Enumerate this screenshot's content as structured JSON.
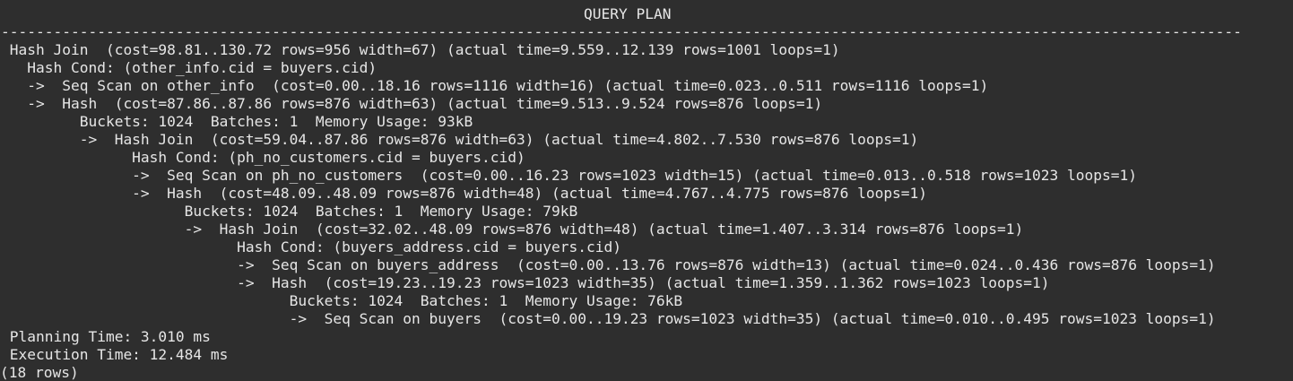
{
  "terminal": {
    "header": "QUERY PLAN",
    "separator": "----------------------------------------------------------------------------------------------------------------------------------------------",
    "plan_lines": [
      " Hash Join  (cost=98.81..130.72 rows=956 width=67) (actual time=9.559..12.139 rows=1001 loops=1)",
      "   Hash Cond: (other_info.cid = buyers.cid)",
      "   ->  Seq Scan on other_info  (cost=0.00..18.16 rows=1116 width=16) (actual time=0.023..0.511 rows=1116 loops=1)",
      "   ->  Hash  (cost=87.86..87.86 rows=876 width=63) (actual time=9.513..9.524 rows=876 loops=1)",
      "         Buckets: 1024  Batches: 1  Memory Usage: 93kB",
      "         ->  Hash Join  (cost=59.04..87.86 rows=876 width=63) (actual time=4.802..7.530 rows=876 loops=1)",
      "               Hash Cond: (ph_no_customers.cid = buyers.cid)",
      "               ->  Seq Scan on ph_no_customers  (cost=0.00..16.23 rows=1023 width=15) (actual time=0.013..0.518 rows=1023 loops=1)",
      "               ->  Hash  (cost=48.09..48.09 rows=876 width=48) (actual time=4.767..4.775 rows=876 loops=1)",
      "                     Buckets: 1024  Batches: 1  Memory Usage: 79kB",
      "                     ->  Hash Join  (cost=32.02..48.09 rows=876 width=48) (actual time=1.407..3.314 rows=876 loops=1)",
      "                           Hash Cond: (buyers_address.cid = buyers.cid)",
      "                           ->  Seq Scan on buyers_address  (cost=0.00..13.76 rows=876 width=13) (actual time=0.024..0.436 rows=876 loops=1)",
      "                           ->  Hash  (cost=19.23..19.23 rows=1023 width=35) (actual time=1.359..1.362 rows=1023 loops=1)",
      "                                 Buckets: 1024  Batches: 1  Memory Usage: 76kB",
      "                                 ->  Seq Scan on buyers  (cost=0.00..19.23 rows=1023 width=35) (actual time=0.010..0.495 rows=1023 loops=1)",
      " Planning Time: 3.010 ms",
      " Execution Time: 12.484 ms"
    ],
    "row_count": "(18 rows)"
  }
}
